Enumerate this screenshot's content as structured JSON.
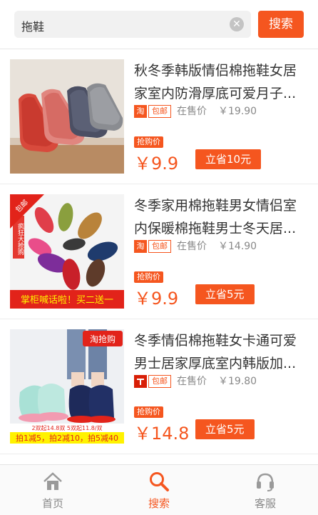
{
  "search": {
    "value": "拖鞋",
    "button_label": "搜索"
  },
  "products": [
    {
      "title": "秋冬季韩版情侣棉拖鞋女居家室内防滑厚底可爱月子...",
      "shop_icon": "淘",
      "freeship": "包邮",
      "status": "在售价",
      "orig_price": "￥19.90",
      "deal_tag": "抢购价",
      "price": "￥9.9",
      "save_label": "立省10元"
    },
    {
      "title": "冬季家用棉拖鞋男女情侣室内保暖棉拖鞋男士冬天居...",
      "shop_icon": "淘",
      "freeship": "包邮",
      "status": "在售价",
      "orig_price": "￥14.90",
      "deal_tag": "抢购价",
      "price": "￥9.9",
      "save_label": "立省5元",
      "thumb_text": {
        "corner": "包邮",
        "banner": "掌柜喊话啦！买二送一",
        "side": "疯狂大抢购"
      }
    },
    {
      "title": "冬季情侣棉拖鞋女卡通可爱男士居家厚底室内韩版加...",
      "shop_icon": "天猫",
      "freeship": "包邮",
      "status": "在售价",
      "orig_price": "￥19.80",
      "deal_tag": "抢购价",
      "price": "￥14.8",
      "save_label": "立省5元",
      "thumb_text": {
        "corner": "淘抢购",
        "small": "2双起14.8双 5双起11.8/双",
        "banner": "拍1减5，拍2减10，拍5减40"
      }
    }
  ],
  "tabbar": {
    "home": "首页",
    "search": "搜索",
    "service": "客服"
  },
  "colors": {
    "accent": "#f5561f"
  }
}
